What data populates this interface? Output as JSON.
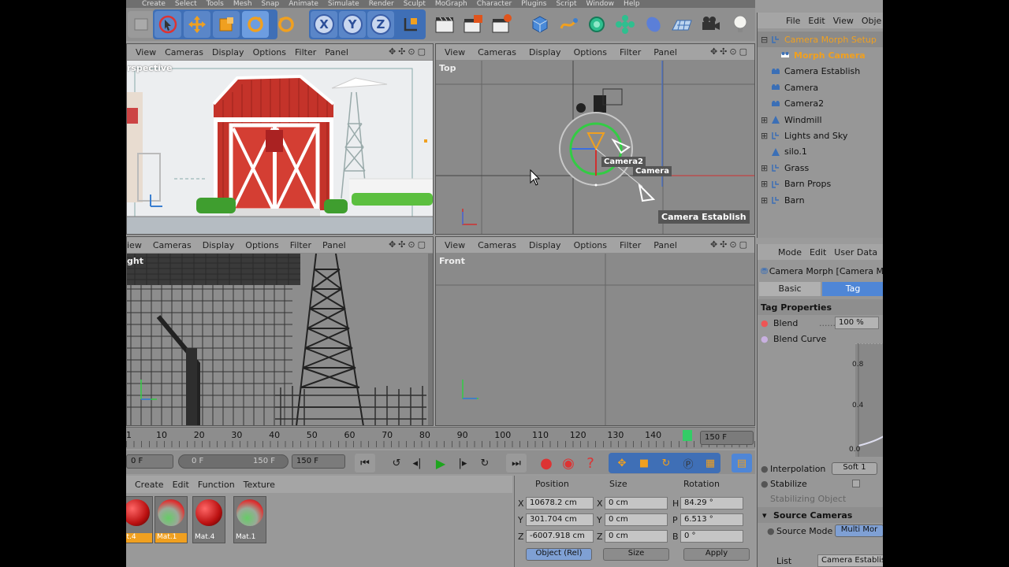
{
  "main_menu": [
    "Create",
    "Select",
    "Tools",
    "Mesh",
    "Snap",
    "Animate",
    "Simulate",
    "Render",
    "Sculpt",
    "MoGraph",
    "Character",
    "Plugins",
    "Script",
    "Window",
    "Help"
  ],
  "toolbar": {
    "axis_x": "X",
    "axis_y": "Y",
    "axis_z": "Z"
  },
  "viewports": {
    "menu": [
      "View",
      "Cameras",
      "Display",
      "Options",
      "Filter",
      "Panel"
    ],
    "perspective": {
      "label": "rspective"
    },
    "top": {
      "label": "Top",
      "camera2": "Camera2",
      "camera": "Camera",
      "camera_establish": "Camera Establish"
    },
    "right": {
      "label": "ght",
      "first_menu": "iew"
    },
    "front": {
      "label": "Front"
    }
  },
  "timeline": {
    "ticks": [
      "10",
      "20",
      "30",
      "40",
      "50",
      "60",
      "70",
      "80",
      "90",
      "100",
      "110",
      "120",
      "130",
      "140"
    ],
    "first_tick": "1",
    "end_field": "150 F",
    "current": "0 F",
    "range_start": "0 F",
    "range_end": "150 F",
    "max": "150 F"
  },
  "materials": {
    "menu": [
      "Create",
      "Edit",
      "Function",
      "Texture"
    ],
    "items": [
      {
        "label": "at.4",
        "kind": "red"
      },
      {
        "label": "Mat.1",
        "kind": "green"
      },
      {
        "label": "Mat.4",
        "kind": "red"
      },
      {
        "label": "Mat.1",
        "kind": "green"
      }
    ]
  },
  "coords": {
    "headers": {
      "position": "Position",
      "size": "Size",
      "rotation": "Rotation"
    },
    "rows": [
      {
        "axis": "X",
        "pos": "10678.2 cm",
        "size_axis": "X",
        "size": "0 cm",
        "rot_axis": "H",
        "rot": "84.29 °"
      },
      {
        "axis": "Y",
        "pos": "301.704 cm",
        "size_axis": "Y",
        "size": "0 cm",
        "rot_axis": "P",
        "rot": "6.513 °"
      },
      {
        "axis": "Z",
        "pos": "-6007.918 cm",
        "size_axis": "Z",
        "size": "0 cm",
        "rot_axis": "B",
        "rot": "0 °"
      }
    ],
    "mode": "Object (Rel)",
    "size_mode": "Size",
    "apply": "Apply"
  },
  "objects": {
    "menu": [
      "File",
      "Edit",
      "View",
      "Obje"
    ],
    "items": [
      {
        "name": "Camera Morph Setup",
        "style": "orange",
        "expand": "⊟",
        "indent": 0
      },
      {
        "name": "Morph Camera",
        "style": "orange-bold",
        "expand": "",
        "indent": 1
      },
      {
        "name": "Camera Establish",
        "style": "normal",
        "expand": "",
        "indent": 0
      },
      {
        "name": "Camera",
        "style": "normal",
        "expand": "",
        "indent": 0
      },
      {
        "name": "Camera2",
        "style": "normal",
        "expand": "",
        "indent": 0
      },
      {
        "name": "Windmill",
        "style": "normal",
        "expand": "⊞",
        "indent": 0
      },
      {
        "name": "Lights and Sky",
        "style": "normal",
        "expand": "⊞",
        "indent": 0
      },
      {
        "name": "silo.1",
        "style": "normal",
        "expand": "",
        "indent": 0
      },
      {
        "name": "Grass",
        "style": "normal",
        "expand": "⊞",
        "indent": 0
      },
      {
        "name": "Barn Props",
        "style": "normal",
        "expand": "⊞",
        "indent": 0
      },
      {
        "name": "Barn",
        "style": "normal",
        "expand": "⊞",
        "indent": 0
      }
    ]
  },
  "attributes": {
    "menu": [
      "Mode",
      "Edit",
      "User Data"
    ],
    "title": "Camera Morph [Camera M",
    "tabs": {
      "basic": "Basic",
      "tag": "Tag"
    },
    "section": "Tag Properties",
    "blend_label": "Blend",
    "blend_value": "100 %",
    "blend_curve": "Blend Curve",
    "curve_ticks": [
      "0.8",
      "0.4",
      "0.0"
    ],
    "interpolation_label": "Interpolation",
    "interpolation_value": "Soft 1",
    "stabilize": "Stabilize",
    "stabilizing_object": "Stabilizing Object",
    "source_section": "Source Cameras",
    "source_mode_label": "Source Mode",
    "source_mode_value": "Multi Mor",
    "list_label": "List",
    "list_value": "Camera Establis"
  },
  "colors": {
    "accent_orange": "#f0a020",
    "selected_blue": "#4f86d6",
    "barn_red": "#c4332a"
  }
}
